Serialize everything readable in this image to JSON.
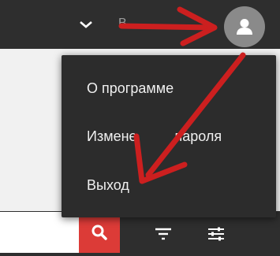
{
  "header": {
    "chevron_icon": "chevron-down-icon",
    "obscured_label": "В",
    "avatar_icon": "user-icon"
  },
  "user_menu": {
    "items": [
      {
        "label": "О программе"
      },
      {
        "label": "Измене"
      },
      {
        "label": "Выход"
      }
    ],
    "partial_tail": "пароля"
  },
  "search": {
    "value": "",
    "button_icon": "search-icon",
    "button_color": "#dc3b37"
  },
  "toolbar": {
    "filter_icon": "filter-icon",
    "settings_icon": "sliders-icon"
  },
  "annotation": {
    "arrow_color": "#cc1f1f",
    "arrow_icon": "arrow-icon"
  }
}
